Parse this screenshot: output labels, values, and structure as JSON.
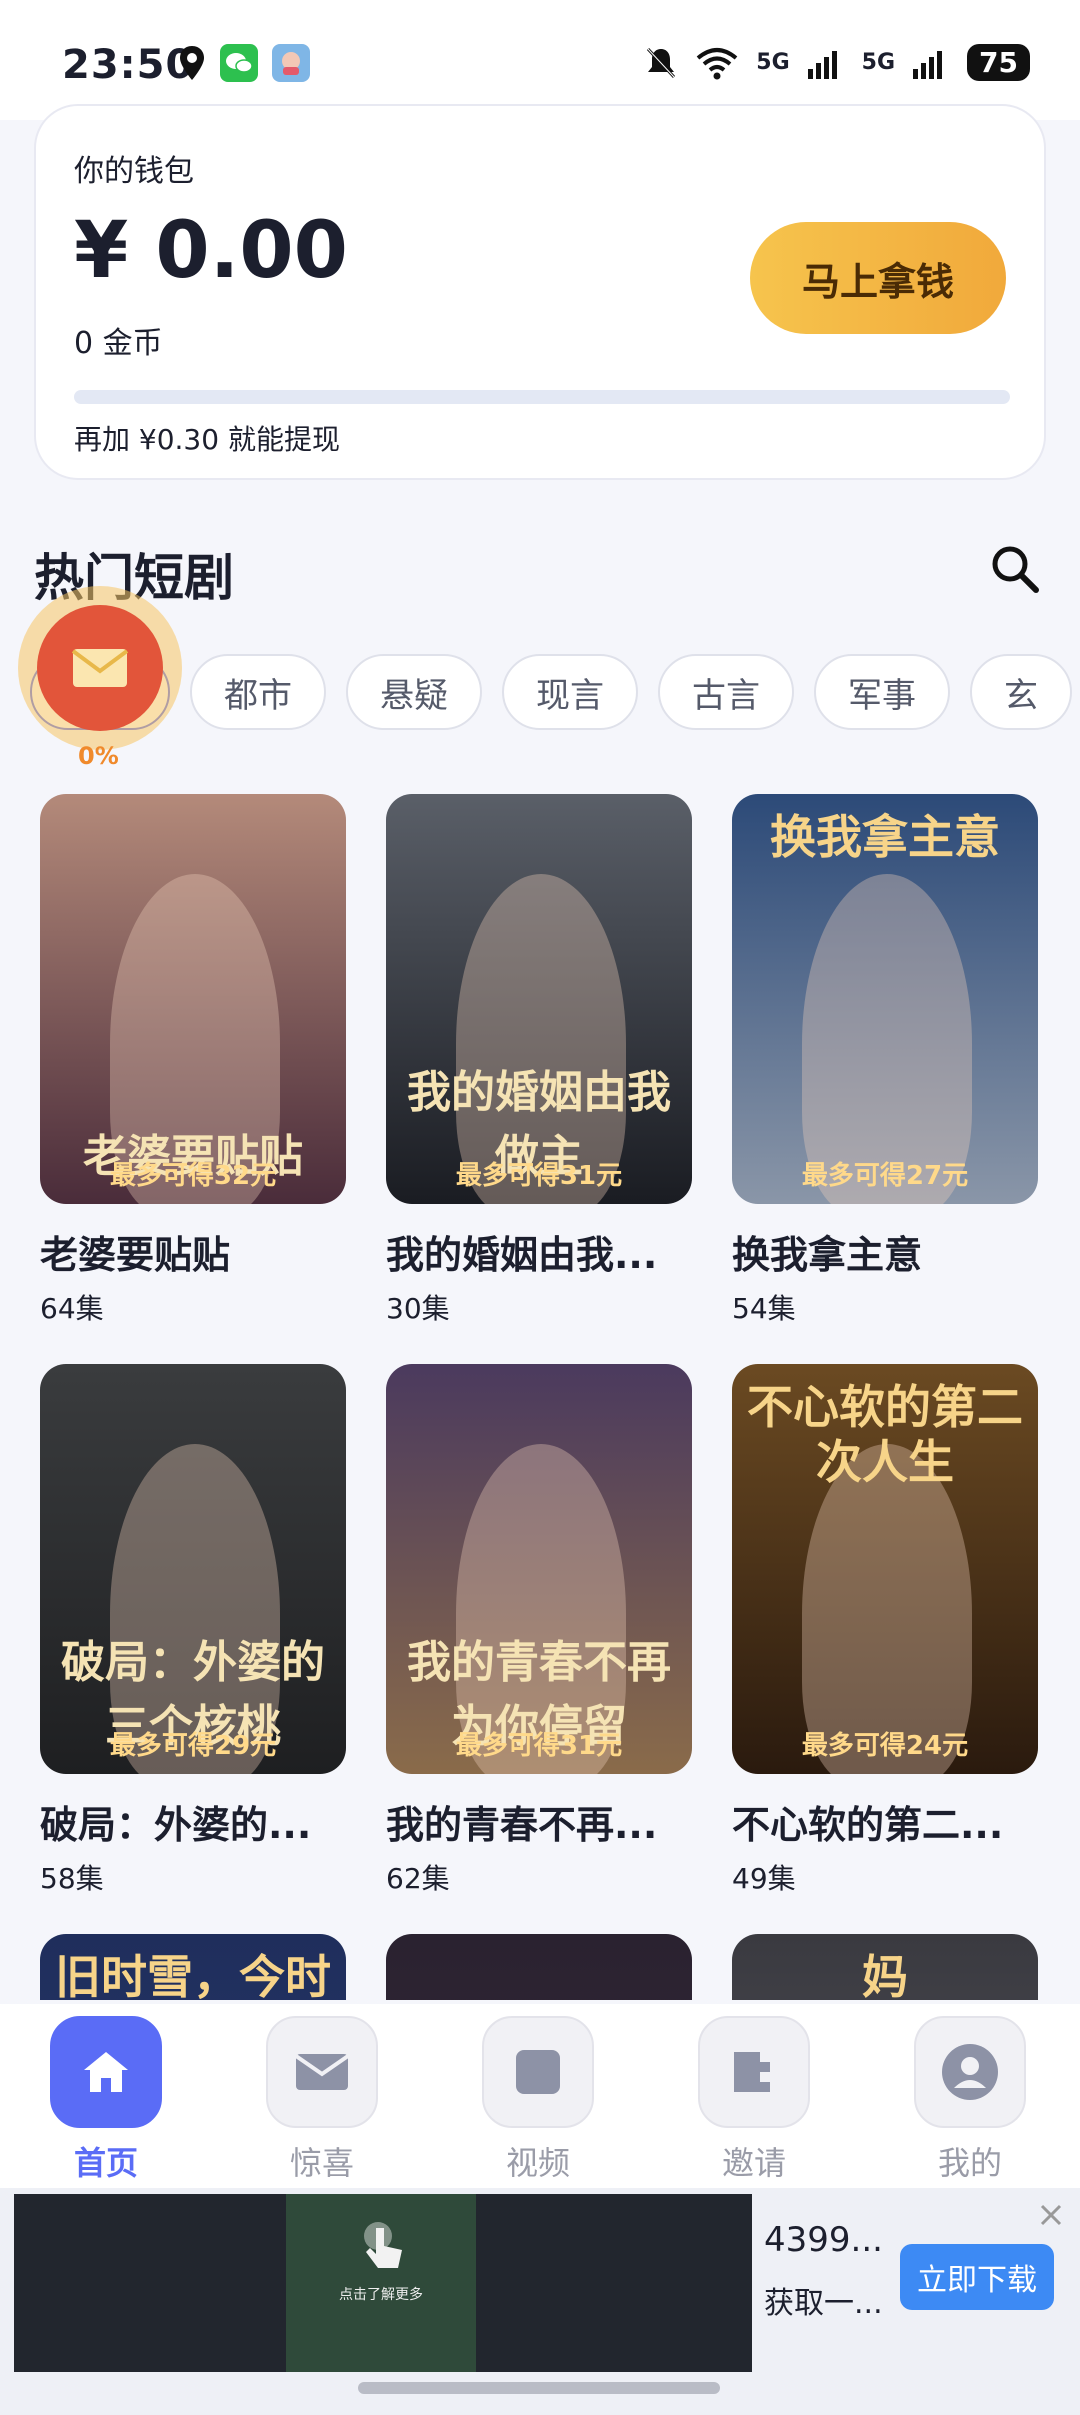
{
  "status_bar": {
    "time": "23:50",
    "signal1": "5G",
    "signal2": "5G",
    "battery": "75"
  },
  "wallet": {
    "title": "你的钱包",
    "amount": "¥ 0.00",
    "coins": "0 金币",
    "button_label": "马上拿钱",
    "hint": "再加 ¥0.30 就能提现",
    "progress": 0
  },
  "section": {
    "title": "热门短剧"
  },
  "floating_reward": {
    "percent": "0%"
  },
  "chips": [
    "",
    "都市",
    "悬疑",
    "现言",
    "古言",
    "军事",
    "玄"
  ],
  "dramas": [
    {
      "title": "老婆要贴贴",
      "episodes": "64集",
      "reward": "最多可得32元",
      "poster_title": "老婆要贴贴",
      "color_top": "#b48a7a",
      "color_bottom": "#4a2c3a"
    },
    {
      "title": "我的婚姻由我...",
      "episodes": "30集",
      "reward": "最多可得31元",
      "poster_title": "我的婚姻由我做主",
      "color_top": "#5a5f68",
      "color_bottom": "#1a1c22"
    },
    {
      "title": "换我拿主意",
      "episodes": "54集",
      "reward": "最多可得27元",
      "poster_title": "换我拿主意",
      "color_top": "#2c4a78",
      "color_bottom": "#8a96a8"
    },
    {
      "title": "破局：外婆的...",
      "episodes": "58集",
      "reward": "最多可得29元",
      "poster_title": "破局：外婆的三个核桃",
      "color_top": "#3a3c3e",
      "color_bottom": "#1e1f21"
    },
    {
      "title": "我的青春不再...",
      "episodes": "62集",
      "reward": "最多可得31元",
      "poster_title": "我的青春不再为你停留",
      "color_top": "#4b3a5e",
      "color_bottom": "#8a6b4a"
    },
    {
      "title": "不心软的第二...",
      "episodes": "49集",
      "reward": "最多可得24元",
      "poster_title": "不心软的第二次人生",
      "color_top": "#6b4a22",
      "color_bottom": "#2a1a0e"
    },
    {
      "title": "",
      "episodes": "",
      "reward": "",
      "poster_title": "旧时雪，今时月",
      "color_top": "#1f2e5c",
      "color_bottom": "#2a3a6e"
    },
    {
      "title": "",
      "episodes": "",
      "reward": "",
      "poster_title": "",
      "color_top": "#2a2230",
      "color_bottom": "#3a2a3a"
    },
    {
      "title": "",
      "episodes": "",
      "reward": "",
      "poster_title": "妈",
      "color_top": "#3a3a40",
      "color_bottom": "#555560"
    }
  ],
  "nav": [
    {
      "label": "首页",
      "icon": "home-icon",
      "active": true
    },
    {
      "label": "惊喜",
      "icon": "envelope-icon",
      "active": false
    },
    {
      "label": "视频",
      "icon": "video-icon",
      "active": false
    },
    {
      "label": "邀请",
      "icon": "invite-icon",
      "active": false
    },
    {
      "label": "我的",
      "icon": "profile-icon",
      "active": false
    }
  ],
  "ad": {
    "title": "4399...",
    "subtitle": "获取一...",
    "button_label": "立即下载",
    "media_caption": "点击了解更多"
  },
  "colors": {
    "accent": "#5a6cf6",
    "gold": "#f6c44d"
  }
}
